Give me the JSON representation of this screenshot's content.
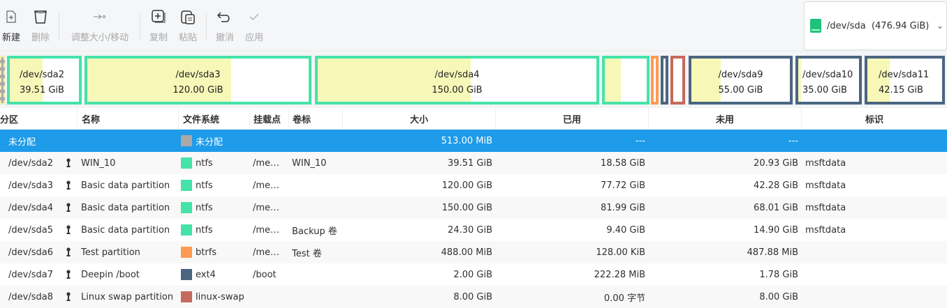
{
  "toolbar": {
    "new": "新建",
    "delete": "删除",
    "resize": "调整大小/移动",
    "copy": "复制",
    "paste": "粘贴",
    "undo": "撤消",
    "apply": "应用"
  },
  "device": {
    "path": "/dev/sda",
    "size": "(476.94 GiB)"
  },
  "map": [
    {
      "name": "/dev/sda2",
      "size": "39.51 GiB",
      "used_fraction": 0.47
    },
    {
      "name": "/dev/sda3",
      "size": "120.00 GiB",
      "used_fraction": 0.65
    },
    {
      "name": "/dev/sda4",
      "size": "150.00 GiB",
      "used_fraction": 0.55
    },
    {
      "used_fraction": 0.39
    },
    {
      "used_fraction": 0.0
    },
    {
      "used_fraction": 0.0
    },
    {
      "used_fraction": 0.0
    },
    {
      "name": "/dev/sda9",
      "size": "55.00 GiB",
      "used_fraction": 0.3
    },
    {
      "name": "/dev/sda10",
      "size": "35.00 GiB",
      "used_fraction": 0.05
    },
    {
      "name": "/dev/sda11",
      "size": "42.15 GiB",
      "used_fraction": 0.3
    }
  ],
  "colors": {
    "ntfs": "#45e3a9",
    "btrfs": "#ff9a50",
    "ext4": "#4a6580",
    "linux-swap": "#c46a5c",
    "unallocated": "#a9a9a9",
    "selected": "#1e9be9"
  },
  "table": {
    "headers": [
      "分区",
      "名称",
      "文件系统",
      "挂载点",
      "卷标",
      "大小",
      "已用",
      "未用",
      "标识"
    ],
    "rows": [
      {
        "part": "未分配",
        "name": "",
        "fs": "未分配",
        "fscolor": "#a9a9a9",
        "mount": "",
        "label": "",
        "size": "513.00 MiB",
        "used": "---",
        "unused": "---",
        "flags": ""
      },
      {
        "part": "/dev/sda2",
        "name": "WIN_10",
        "fs": "ntfs",
        "fscolor": "#45e3a9",
        "mount": "/me…",
        "label": "WIN_10",
        "size": "39.51 GiB",
        "used": "18.58 GiB",
        "unused": "20.93 GiB",
        "flags": "msftdata"
      },
      {
        "part": "/dev/sda3",
        "name": "Basic data partition",
        "fs": "ntfs",
        "fscolor": "#45e3a9",
        "mount": "/me…",
        "label": "",
        "size": "120.00 GiB",
        "used": "77.72 GiB",
        "unused": "42.28 GiB",
        "flags": "msftdata"
      },
      {
        "part": "/dev/sda4",
        "name": "Basic data partition",
        "fs": "ntfs",
        "fscolor": "#45e3a9",
        "mount": "/me…",
        "label": "",
        "size": "150.00 GiB",
        "used": "81.99 GiB",
        "unused": "68.01 GiB",
        "flags": "msftdata"
      },
      {
        "part": "/dev/sda5",
        "name": "Basic data partition",
        "fs": "ntfs",
        "fscolor": "#45e3a9",
        "mount": "/me…",
        "label": "Backup 卷",
        "size": "24.30 GiB",
        "used": "9.40 GiB",
        "unused": "14.90 GiB",
        "flags": "msftdata"
      },
      {
        "part": "/dev/sda6",
        "name": "Test partition",
        "fs": "btrfs",
        "fscolor": "#ff9a50",
        "mount": "/me…",
        "label": "Test 卷",
        "size": "488.00 MiB",
        "used": "128.00 KiB",
        "unused": "487.88 MiB",
        "flags": ""
      },
      {
        "part": "/dev/sda7",
        "name": "Deepin /boot",
        "fs": "ext4",
        "fscolor": "#4a6580",
        "mount": "/boot",
        "label": "",
        "size": "2.00 GiB",
        "used": "222.28 MiB",
        "unused": "1.78 GiB",
        "flags": ""
      },
      {
        "part": "/dev/sda8",
        "name": "Linux swap partition",
        "fs": "linux-swap",
        "fscolor": "#c46a5c",
        "mount": "",
        "label": "",
        "size": "8.00 GiB",
        "used": "0.00 字节",
        "unused": "8.00 GiB",
        "flags": ""
      }
    ]
  }
}
